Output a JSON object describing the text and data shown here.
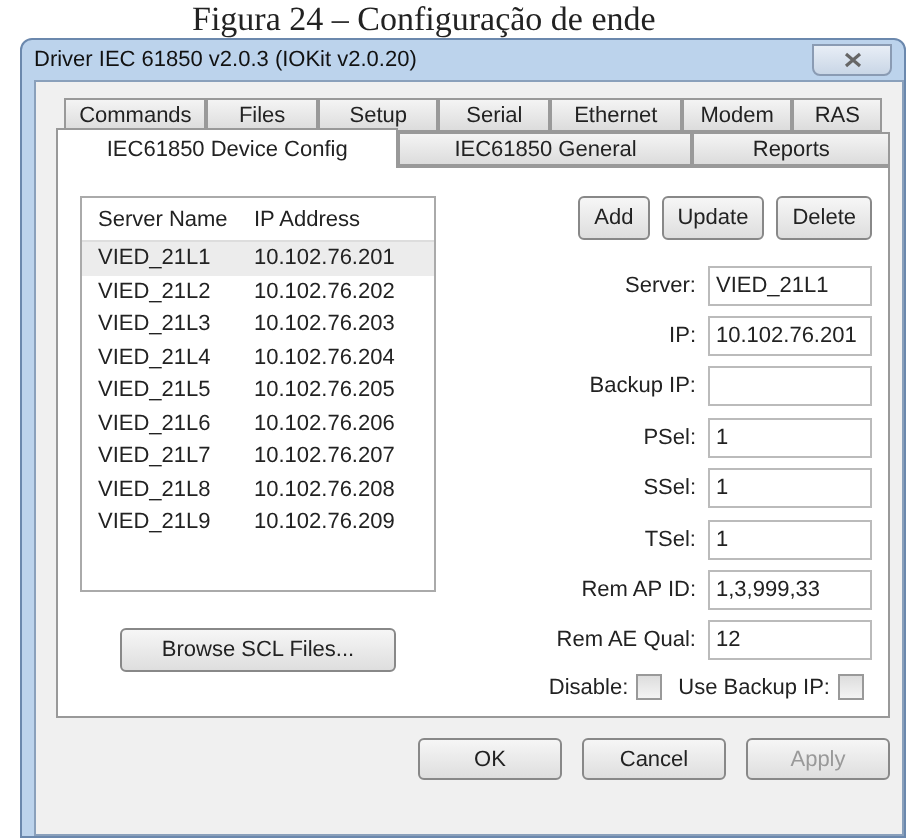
{
  "caption": "Figura 24 – Configuração de ende",
  "window": {
    "title": "Driver IEC 61850 v2.0.3 (IOKit v2.0.20)"
  },
  "tab_rows": [
    [
      {
        "label": "Commands",
        "selected": false
      },
      {
        "label": "Files",
        "selected": false
      },
      {
        "label": "Setup",
        "selected": false
      },
      {
        "label": "Serial",
        "selected": false
      },
      {
        "label": "Ethernet",
        "selected": false
      },
      {
        "label": "Modem",
        "selected": false
      },
      {
        "label": "RAS",
        "selected": false
      }
    ],
    [
      {
        "label": "IEC61850 Device Config",
        "selected": true
      },
      {
        "label": "IEC61850 General",
        "selected": false
      },
      {
        "label": "Reports",
        "selected": false
      }
    ]
  ],
  "server_list": {
    "columns": [
      "Server Name",
      "IP Address"
    ],
    "rows": [
      {
        "name": "VIED_21L1",
        "ip": "10.102.76.201",
        "selected": true
      },
      {
        "name": "VIED_21L2",
        "ip": "10.102.76.202",
        "selected": false
      },
      {
        "name": "VIED_21L3",
        "ip": "10.102.76.203",
        "selected": false
      },
      {
        "name": "VIED_21L4",
        "ip": "10.102.76.204",
        "selected": false
      },
      {
        "name": "VIED_21L5",
        "ip": "10.102.76.205",
        "selected": false
      },
      {
        "name": "VIED_21L6",
        "ip": "10.102.76.206",
        "selected": false
      },
      {
        "name": "VIED_21L7",
        "ip": "10.102.76.207",
        "selected": false
      },
      {
        "name": "VIED_21L8",
        "ip": "10.102.76.208",
        "selected": false
      },
      {
        "name": "VIED_21L9",
        "ip": "10.102.76.209",
        "selected": false
      }
    ]
  },
  "browse_button": "Browse SCL Files...",
  "action_buttons": [
    "Add",
    "Update",
    "Delete"
  ],
  "fields": [
    {
      "label": "Server:",
      "value": "VIED_21L1"
    },
    {
      "label": "IP:",
      "value": "10.102.76.201"
    },
    {
      "label": "Backup IP:"
    },
    {
      "label": "PSel:",
      "value": "1"
    },
    {
      "label": "SSel:",
      "value": "1"
    },
    {
      "label": "TSel:",
      "value": "1"
    },
    {
      "label": "Rem AP ID:",
      "value": "1,3,999,33"
    },
    {
      "label": "Rem AE Qual:",
      "value": "12"
    }
  ],
  "checkboxes": [
    {
      "label": "Disable:",
      "checked": false
    },
    {
      "label": "Use Backup IP:",
      "checked": false
    }
  ],
  "footer_buttons": [
    {
      "label": "OK",
      "disabled": false
    },
    {
      "label": "Cancel",
      "disabled": false
    },
    {
      "label": "Apply",
      "disabled": true
    }
  ]
}
